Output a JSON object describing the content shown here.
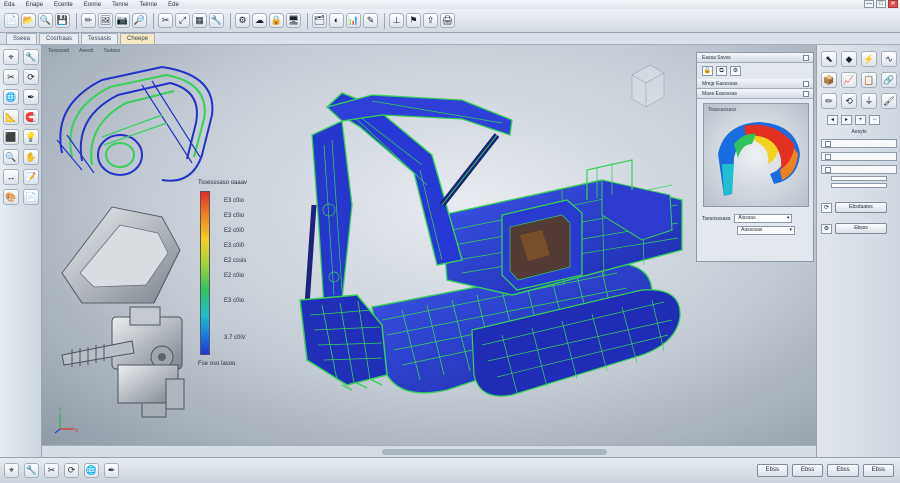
{
  "menu": [
    "Eda",
    "Enape",
    "Ecerite",
    "Eonne",
    "Tenne",
    "Teinne",
    "Ede"
  ],
  "window_controls": [
    "—",
    "□",
    "✕"
  ],
  "toolbar_icons": [
    {
      "name": "new-file-icon",
      "glyph": "📄"
    },
    {
      "name": "open-folder-icon",
      "glyph": "📂"
    },
    {
      "name": "search-icon",
      "glyph": "🔍"
    },
    {
      "name": "save-icon",
      "glyph": "💾"
    },
    {
      "name": "edit-icon",
      "glyph": "✏"
    },
    {
      "name": "image-icon",
      "glyph": "🖼"
    },
    {
      "name": "camera-icon",
      "glyph": "📷"
    },
    {
      "name": "zoom-icon",
      "glyph": "🔎"
    },
    {
      "name": "cut-icon",
      "glyph": "✂"
    },
    {
      "name": "transform-icon",
      "glyph": "⤢"
    },
    {
      "name": "mesh-icon",
      "glyph": "▦"
    },
    {
      "name": "tools-icon",
      "glyph": "🔧"
    },
    {
      "name": "gear-icon",
      "glyph": "⚙"
    },
    {
      "name": "cloud-icon",
      "glyph": "☁"
    },
    {
      "name": "lock-icon",
      "glyph": "🔒"
    },
    {
      "name": "monitor-icon",
      "glyph": "🖥"
    },
    {
      "name": "layers-icon",
      "glyph": "🗂"
    },
    {
      "name": "render-icon",
      "glyph": "◐"
    },
    {
      "name": "analysis-icon",
      "glyph": "📊"
    },
    {
      "name": "sketch-icon",
      "glyph": "✎"
    },
    {
      "name": "constraint-icon",
      "glyph": "⊥"
    },
    {
      "name": "flag-icon",
      "glyph": "⚑"
    },
    {
      "name": "export-icon",
      "glyph": "⇪"
    },
    {
      "name": "print-icon",
      "glyph": "🖨"
    }
  ],
  "tabs": [
    {
      "label": "Sseea",
      "active": false
    },
    {
      "label": "Cosrtraas",
      "active": false
    },
    {
      "label": "Tessasis",
      "active": false
    },
    {
      "label": "Cheepe",
      "active": true
    }
  ],
  "left_tools": [
    {
      "name": "select-icon",
      "glyph": "⌖"
    },
    {
      "name": "wrench-icon",
      "glyph": "🔧"
    },
    {
      "name": "scissors-icon",
      "glyph": "✂"
    },
    {
      "name": "rotate-icon",
      "glyph": "⟳"
    },
    {
      "name": "globe-icon",
      "glyph": "🌐"
    },
    {
      "name": "pen-icon",
      "glyph": "✒"
    },
    {
      "name": "measure-icon",
      "glyph": "📐"
    },
    {
      "name": "magnet-icon",
      "glyph": "🧲"
    },
    {
      "name": "cube-icon",
      "glyph": "⬛"
    },
    {
      "name": "lightbulb-icon",
      "glyph": "💡"
    },
    {
      "name": "zoom-in-icon",
      "glyph": "🔍"
    },
    {
      "name": "pan-icon",
      "glyph": "✋"
    },
    {
      "name": "dimension-icon",
      "glyph": "↔"
    },
    {
      "name": "notes-icon",
      "glyph": "📝"
    },
    {
      "name": "palette-icon",
      "glyph": "🎨"
    },
    {
      "name": "document-icon",
      "glyph": "📄"
    }
  ],
  "viewport_tabs": [
    "Teesssatt",
    "Aeestt",
    "Tsstass"
  ],
  "legend": {
    "title": "Tssesssaso oaaav",
    "labels": [
      "E3 c0io",
      "E3 c0io",
      "E2 c0i0",
      "E3 c0i0",
      "E2 cssis",
      "E2 c0io",
      "E3 c0io",
      "3.7 c0iV"
    ],
    "footer": "Fse oso lasoo"
  },
  "triad": {
    "y": "Y",
    "x": "x"
  },
  "props": {
    "header1": "Eassa  Ssvss",
    "header2": "Mmgr Eassssas",
    "header3": "Mase Eassssas",
    "thumb_label": "Tsassassass",
    "line_label": "Tsesosssass",
    "dropdown1": "Aisssas",
    "dropdown2": "Aassssas"
  },
  "right_tools": [
    {
      "name": "pointer-icon",
      "glyph": "⬉"
    },
    {
      "name": "shapes-icon",
      "glyph": "◆"
    },
    {
      "name": "bolt-icon",
      "glyph": "⚡"
    },
    {
      "name": "curve-icon",
      "glyph": "∿"
    },
    {
      "name": "box-icon",
      "glyph": "📦"
    },
    {
      "name": "chart-icon",
      "glyph": "📈"
    },
    {
      "name": "clipboard-icon",
      "glyph": "📋"
    },
    {
      "name": "link-icon",
      "glyph": "🔗"
    },
    {
      "name": "pencil-icon",
      "glyph": "✏"
    },
    {
      "name": "refresh-icon",
      "glyph": "⟲"
    },
    {
      "name": "filter-icon",
      "glyph": "⏚"
    },
    {
      "name": "brush-icon",
      "glyph": "🖌"
    }
  ],
  "right_panel": {
    "title": "Aesyts",
    "button": "Ebsdaates",
    "bottom_button": "Ebsss"
  },
  "status_buttons": [
    "Ebss",
    "Ebss",
    "Ebss",
    "Ebss"
  ],
  "colors": {
    "wire_blue": "#2433d6",
    "wire_green": "#37d05a",
    "heat_red": "#e33020",
    "heat_yellow": "#f4d21e",
    "panel_bg": "#e3e8ee"
  }
}
